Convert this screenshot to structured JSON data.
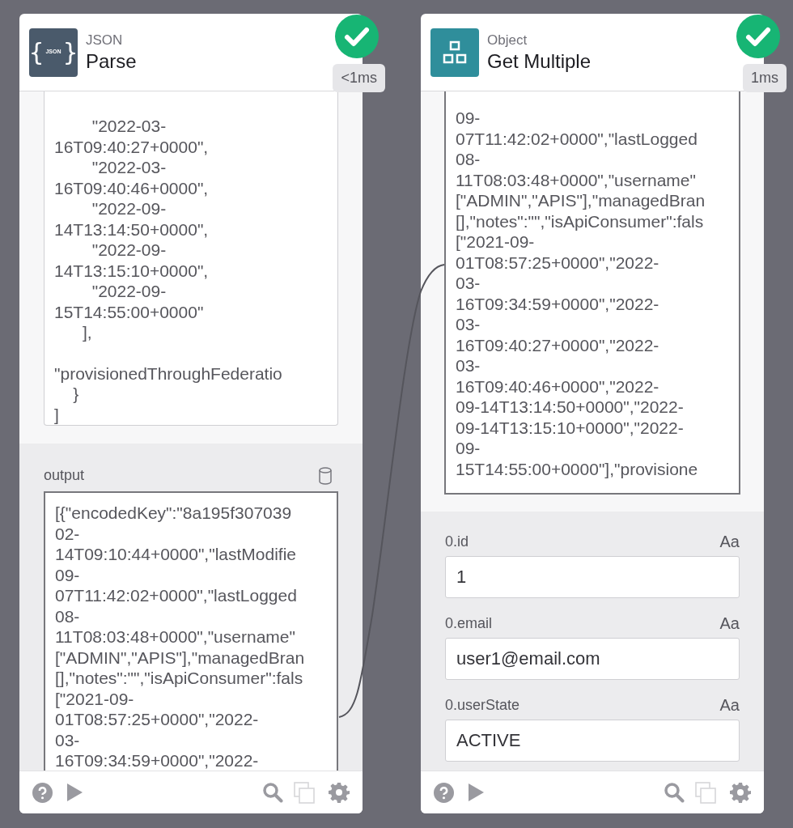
{
  "nodes": [
    {
      "category": "JSON",
      "title": "Parse",
      "logo": {
        "kind": "braces",
        "open": "{",
        "text": "JSON",
        "close": "}"
      },
      "done": true,
      "duration": "<1ms",
      "code_box": {
        "lines": [
          "        \"2022-03-",
          "16T09:40:27+0000\",",
          "        \"2022-03-",
          "16T09:40:46+0000\",",
          "        \"2022-09-",
          "14T13:14:50+0000\",",
          "        \"2022-09-",
          "14T13:15:10+0000\",",
          "        \"2022-09-",
          "15T14:55:00+0000\"",
          "      ],"
        ],
        "after_gap": [
          "\"provisionedThroughFederatio",
          "    }",
          "]"
        ]
      },
      "output": {
        "label": "output",
        "lines": [
          "[{\"encodedKey\":\"8a195f307039",
          "02-",
          "14T09:10:44+0000\",\"lastModifie",
          "09-",
          "07T11:42:02+0000\",\"lastLogged",
          "08-",
          "11T08:03:48+0000\",\"username\"",
          "[\"ADMIN\",\"APIS\"],\"managedBran",
          "[],\"notes\":\"\",\"isApiConsumer\":fals",
          "[\"2021-09-",
          "01T08:57:25+0000\",\"2022-",
          "03-",
          "16T09:34:59+0000\",\"2022-"
        ]
      }
    },
    {
      "category": "Object",
      "title": "Get Multiple",
      "logo": {
        "kind": "blocks"
      },
      "done": true,
      "duration": "1ms",
      "code_box": {
        "lines": [
          "09-",
          "07T11:42:02+0000\",\"lastLogged",
          "08-",
          "11T08:03:48+0000\",\"username\"",
          "[\"ADMIN\",\"APIS\"],\"managedBran",
          "[],\"notes\":\"\",\"isApiConsumer\":fals",
          "[\"2021-09-",
          "01T08:57:25+0000\",\"2022-",
          "03-",
          "16T09:34:59+0000\",\"2022-",
          "03-",
          "16T09:40:27+0000\",\"2022-",
          "03-",
          "16T09:40:46+0000\",\"2022-",
          "09-14T13:14:50+0000\",\"2022-",
          "09-14T13:15:10+0000\",\"2022-",
          "09-",
          "15T14:55:00+0000\"],\"provisione"
        ]
      },
      "fields": [
        {
          "label": "0.id",
          "type_mark": "Aa",
          "value": "1"
        },
        {
          "label": "0.email",
          "type_mark": "Aa",
          "value": "user1@email.com"
        },
        {
          "label": "0.userState",
          "type_mark": "Aa",
          "value": "ACTIVE"
        }
      ]
    }
  ]
}
